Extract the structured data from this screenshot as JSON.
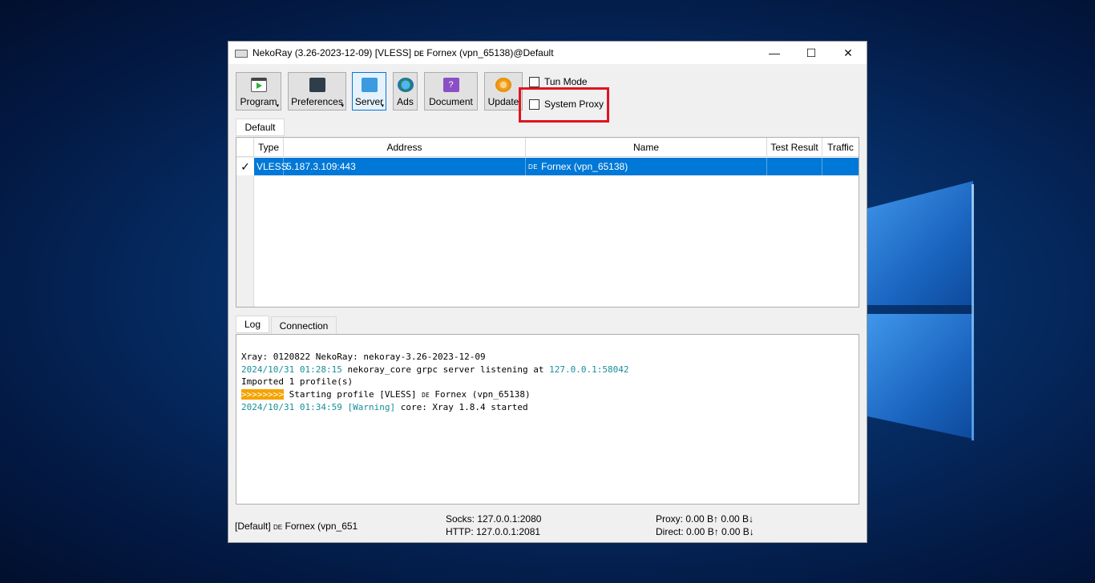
{
  "window": {
    "title": "NekoRay (3.26-2023-12-09) [VLESS] ᴅᴇ Fornex (vpn_65138)@Default",
    "minimize": "—",
    "maximize": "☐",
    "close": "✕"
  },
  "toolbar": {
    "program": "Program",
    "preferences": "Preferences",
    "server": "Server",
    "ads": "Ads",
    "document": "Document",
    "update": "Update",
    "menu_indicator": "▾"
  },
  "options": {
    "tun_mode": "Tun Mode",
    "system_proxy": "System Proxy"
  },
  "group_tab": "Default",
  "table": {
    "headers": [
      "Type",
      "Address",
      "Name",
      "Test Result",
      "Traffic"
    ],
    "rows": [
      {
        "check": "✓",
        "type": "VLESS",
        "address": "5.187.3.109:443",
        "flag": "DE",
        "name": "Fornex (vpn_65138)",
        "test_result": "",
        "traffic": ""
      }
    ]
  },
  "log_tabs": [
    "Log",
    "Connection"
  ],
  "log": {
    "l1": "Xray: 0120822 NekoRay: nekoray-3.26-2023-12-09",
    "l2_time": "2024/10/31 01:28:15",
    "l2_text": " nekoray_core grpc server listening at ",
    "l2_addr": "127.0.0.1:58042",
    "l3": "Imported 1 profile(s)",
    "l4_tag": ">>>>>>>>",
    "l4_text": " Starting profile [VLESS] ",
    "l4_flag": "DE",
    "l4_text2": " Fornex (vpn_65138)",
    "l5_time": "2024/10/31 01:34:59",
    "l5_warn": " [Warning]",
    "l5_text": " core: Xray 1.8.4 started"
  },
  "status": {
    "profile_prefix": "[Default] ",
    "profile_flag": "DE",
    "profile_name": " Fornex (vpn_651",
    "socks": "Socks: 127.0.0.1:2080",
    "http": "HTTP: 127.0.0.1:2081",
    "proxy": "Proxy: 0.00 B↑ 0.00 B↓",
    "direct": "Direct: 0.00 B↑ 0.00 B↓"
  },
  "colors": {
    "selection": "#0078d7",
    "highlight_box": "#e0141e",
    "log_teal": "#168f9b",
    "log_tag": "#f5a300"
  }
}
